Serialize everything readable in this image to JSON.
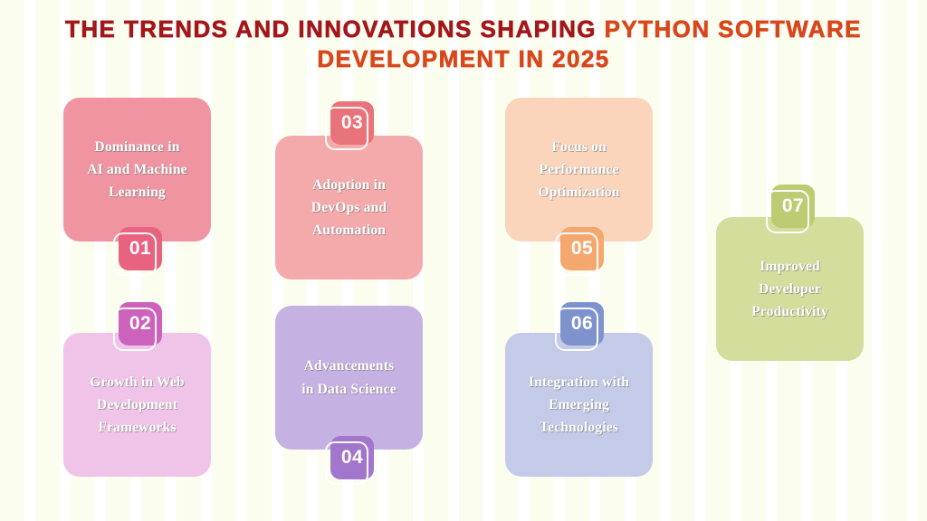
{
  "poster": {
    "background_base": "#ffffff",
    "background_stripe": "#fbfdef"
  },
  "title": {
    "line1_dark": "The Trends and Innovations Shaping ",
    "line1_bright": "Python Software",
    "line2_bright": "Development in 2025",
    "color_dark": "#a3161a",
    "color_bright": "#d8461b"
  },
  "cards": [
    {
      "number": "01",
      "text": "Dominance in\nAI and Machine\nLearning",
      "card_color": "#ef94a0",
      "badge_color": "#e8637f",
      "badge_position": "bottom"
    },
    {
      "number": "02",
      "text": "Growth in Web\nDevelopment\nFrameworks",
      "card_color": "#f0c4e8",
      "badge_color": "#cd62bd",
      "badge_position": "top"
    },
    {
      "number": "03",
      "text": "Adoption in\nDevOps and\nAutomation",
      "card_color": "#f4aaaa",
      "badge_color": "#e9737a",
      "badge_position": "top"
    },
    {
      "number": "04",
      "text": "Advancements\nin Data Science",
      "card_color": "#c6b2e2",
      "badge_color": "#a276cc",
      "badge_position": "bottom"
    },
    {
      "number": "05",
      "text": "Focus on\nPerformance\nOptimization",
      "card_color": "#fad5bb",
      "badge_color": "#f5a86e",
      "badge_position": "bottom"
    },
    {
      "number": "06",
      "text": "Integration with\nEmerging\nTechnologies",
      "card_color": "#c4cbe8",
      "badge_color": "#7e93ce",
      "badge_position": "top"
    },
    {
      "number": "07",
      "text": "Improved\nDeveloper\nProductivity",
      "card_color": "#d4dd9b",
      "badge_color": "#bdcc72",
      "badge_position": "top"
    }
  ]
}
